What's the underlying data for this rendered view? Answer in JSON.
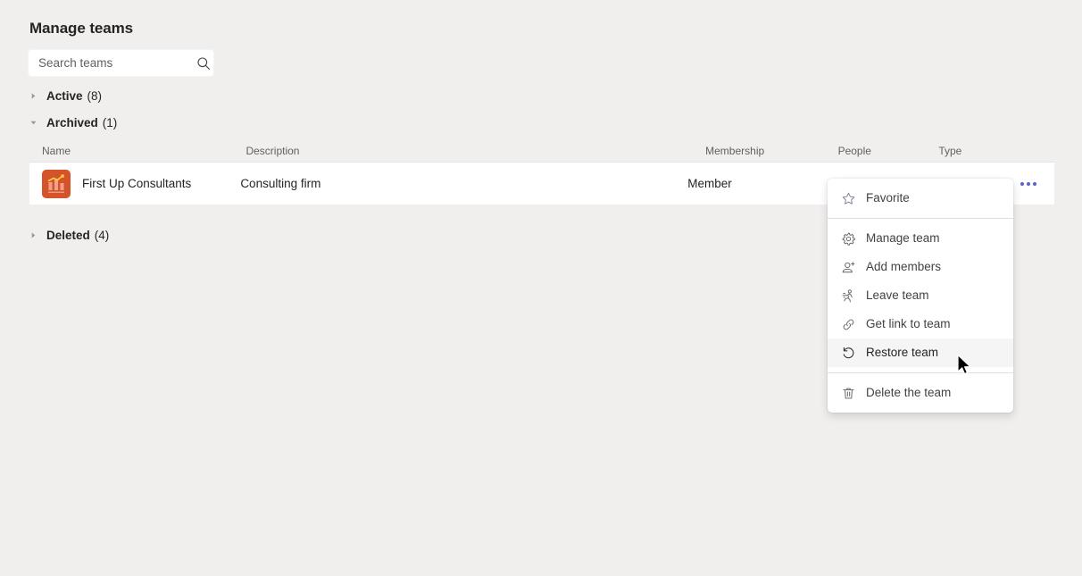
{
  "page": {
    "title": "Manage teams",
    "background_color": "#f0efee"
  },
  "search": {
    "placeholder": "Search teams",
    "value": "",
    "icon": "search-icon"
  },
  "groups": [
    {
      "name": "Active",
      "count": "(8)",
      "expanded": false,
      "icon": "chevron-right-icon"
    },
    {
      "name": "Archived",
      "count": "(1)",
      "expanded": true,
      "icon": "chevron-down-icon"
    },
    {
      "name": "Deleted",
      "count": "(4)",
      "expanded": false,
      "icon": "chevron-right-icon"
    }
  ],
  "table": {
    "columns": {
      "name": "Name",
      "description": "Description",
      "membership": "Membership",
      "people": "People",
      "type": "Type"
    },
    "rows": [
      {
        "name": "First Up Consultants",
        "description": "Consulting firm",
        "membership": "Member",
        "people": "",
        "type": "",
        "avatar_color": "#d4532a",
        "avatar_icon": "bar-chart-icon",
        "more_label": "More options"
      }
    ]
  },
  "context_menu": {
    "groups": [
      {
        "items": [
          {
            "label": "Favorite",
            "icon": "star-icon",
            "hovered": false
          }
        ]
      },
      {
        "items": [
          {
            "label": "Manage team",
            "icon": "gear-icon",
            "hovered": false
          },
          {
            "label": "Add members",
            "icon": "person-add-icon",
            "hovered": false
          },
          {
            "label": "Leave team",
            "icon": "running-person-icon",
            "hovered": false
          },
          {
            "label": "Get link to team",
            "icon": "link-icon",
            "hovered": false
          },
          {
            "label": "Restore team",
            "icon": "restore-icon",
            "hovered": true
          }
        ]
      },
      {
        "items": [
          {
            "label": "Delete the team",
            "icon": "trash-icon",
            "hovered": false
          }
        ]
      }
    ]
  },
  "colors": {
    "brand": "#5b5fc7",
    "avatar": "#d4532a",
    "text_primary": "#242424",
    "text_secondary": "#616161",
    "row_background": "#ffffff",
    "page_background": "#f0efee"
  }
}
